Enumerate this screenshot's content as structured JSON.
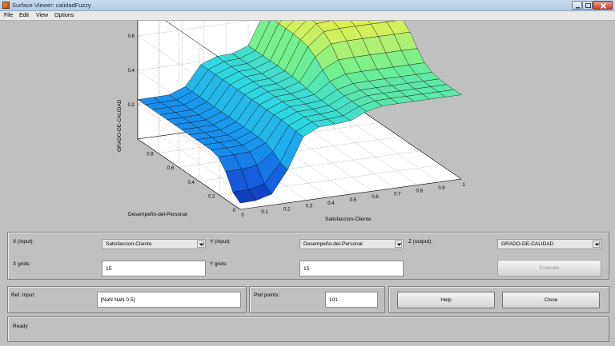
{
  "window": {
    "title": "Surface Viewer: calidadFuzzy"
  },
  "menu": [
    "File",
    "Edit",
    "View",
    "Options"
  ],
  "chart_data": {
    "type": "surface",
    "xlabel": "Satisfaccion-Cliente",
    "ylabel": "Desempeño-del-Personal",
    "zlabel": "GRADO-DE-CALIDAD",
    "xticks": [
      "0",
      "0.1",
      "0.2",
      "0.3",
      "0.4",
      "0.5",
      "0.6",
      "0.7",
      "0.8",
      "0.9",
      "1"
    ],
    "yticks": [
      "0",
      "0.2",
      "0.4",
      "0.6",
      "0.8"
    ],
    "zticks": [
      "0.2",
      "0.4",
      "0.6",
      "0.8"
    ],
    "xlim": [
      0,
      1
    ],
    "ylim": [
      0,
      1
    ],
    "zlim": [
      0,
      0.8
    ],
    "grid_points": 15,
    "colormap": [
      "#0a2aa8",
      "#1560e0",
      "#1aa0f0",
      "#30d6e0",
      "#70f090",
      "#d0f060",
      "#f8f020"
    ]
  },
  "controls": {
    "x_label": "X (input):",
    "x_value": "Satisfaccion-Cliente",
    "y_label": "Y (input):",
    "y_value": "Desempeño-del-Personal",
    "z_label": "Z (output):",
    "z_value": "GRADO-DE-CALIDAD",
    "xgrids_label": "X grids:",
    "xgrids_value": "15",
    "ygrids_label": "Y grids:",
    "ygrids_value": "15",
    "evaluate_label": "Evaluate",
    "refinput_label": "Ref. Input:",
    "refinput_value": "[NaN NaN 0.5]",
    "plotpoints_label": "Plot points:",
    "plotpoints_value": "101",
    "help_label": "Help",
    "close_label": "Close"
  },
  "status": {
    "text": "Ready"
  }
}
